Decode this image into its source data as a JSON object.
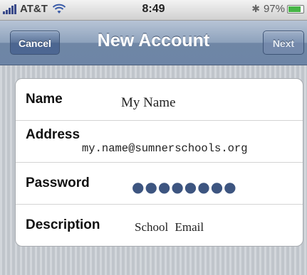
{
  "status_bar": {
    "carrier": "AT&T",
    "time": "8:49",
    "battery_percent": "97%",
    "battery_level": 0.97,
    "icons": [
      "signal-icon",
      "wifi-icon",
      "bluetooth-icon",
      "battery-icon"
    ]
  },
  "nav": {
    "title": "New Account",
    "cancel_label": "Cancel",
    "next_label": "Next",
    "next_enabled": false
  },
  "form": {
    "name": {
      "label": "Name",
      "value": "My Name"
    },
    "address": {
      "label": "Address",
      "value": "my.name@sumnerschools.org"
    },
    "password": {
      "label": "Password",
      "value": "●●●●●●●●"
    },
    "description": {
      "label": "Description",
      "value": "School Email"
    }
  },
  "colors": {
    "nav_bar": "#7d93b3",
    "background": "#c8cdd3",
    "password_dots": "#3d5580",
    "battery_fill": "#46b546"
  }
}
